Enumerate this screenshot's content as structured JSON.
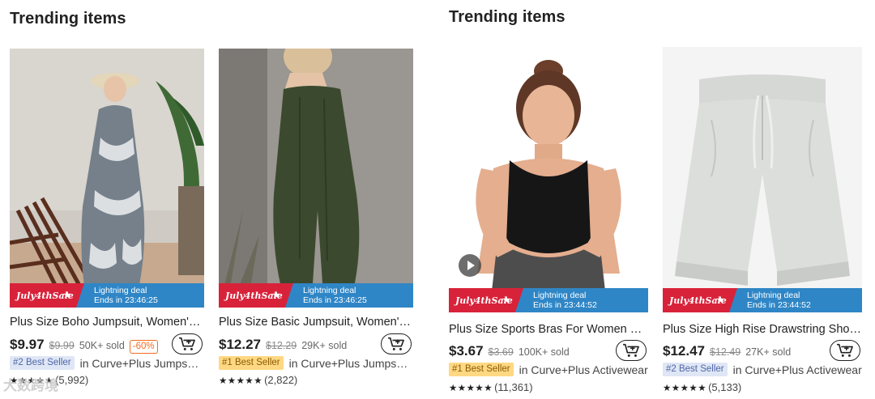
{
  "left_panel": {
    "section_title": "Trending items",
    "cards": [
      {
        "title": "Plus Size Boho Jumpsuit, Women's Plus Tie Dye Cami Jumpsuit",
        "price": "$9.97",
        "original_price": "$9.99",
        "sold": "50K+ sold",
        "discount": "-60%",
        "badge": "#2 Best Seller",
        "badge_color": "blue",
        "category": "in Curve+Plus Jumpsuits",
        "stars": "★★★★★",
        "rating_count": "(5,992)",
        "deal_brand": "July4thSale",
        "deal_line1": "Lightning deal",
        "deal_line2": "Ends in 23:46:25"
      },
      {
        "title": "Plus Size Basic Jumpsuit, Women's Plus Solid Cami Jumpsuit",
        "price": "$12.27",
        "original_price": "$12.29",
        "sold": "29K+ sold",
        "badge": "#1 Best Seller",
        "badge_color": "orange",
        "category": "in Curve+Plus Jumpsuits",
        "stars": "★★★★★",
        "rating_count": "(2,822)",
        "deal_brand": "July4thSale",
        "deal_line1": "Lightning deal",
        "deal_line2": "Ends in 23:46:25"
      }
    ],
    "watermark": "大数跨境"
  },
  "right_panel": {
    "section_title": "Trending items",
    "cards": [
      {
        "title": "Plus Size Sports Bras For Women Seamless",
        "price": "$3.67",
        "original_price": "$3.69",
        "sold": "100K+ sold",
        "badge": "#1 Best Seller",
        "badge_color": "orange",
        "category": "in Curve+Plus Activewear",
        "stars": "★★★★★",
        "rating_count": "(11,361)",
        "deal_brand": "July4thSale",
        "deal_line1": "Lightning deal",
        "deal_line2": "Ends in 23:44:52"
      },
      {
        "title": "Plus Size High Rise Drawstring Shorts",
        "price": "$12.47",
        "original_price": "$12.49",
        "sold": "27K+ sold",
        "badge": "#2 Best Seller",
        "badge_color": "blue",
        "category": "in Curve+Plus Activewear",
        "stars": "★★★★★",
        "rating_count": "(5,133)",
        "deal_brand": "July4thSale",
        "deal_line1": "Lightning deal",
        "deal_line2": "Ends in 23:44:52"
      }
    ]
  },
  "colors": {
    "deal_red": "#d8223a",
    "deal_blue": "#2f86c6",
    "discount_orange": "#f26b1d",
    "badge_blue_bg": "#dfe6f5",
    "badge_orange_bg": "#ffd883"
  }
}
